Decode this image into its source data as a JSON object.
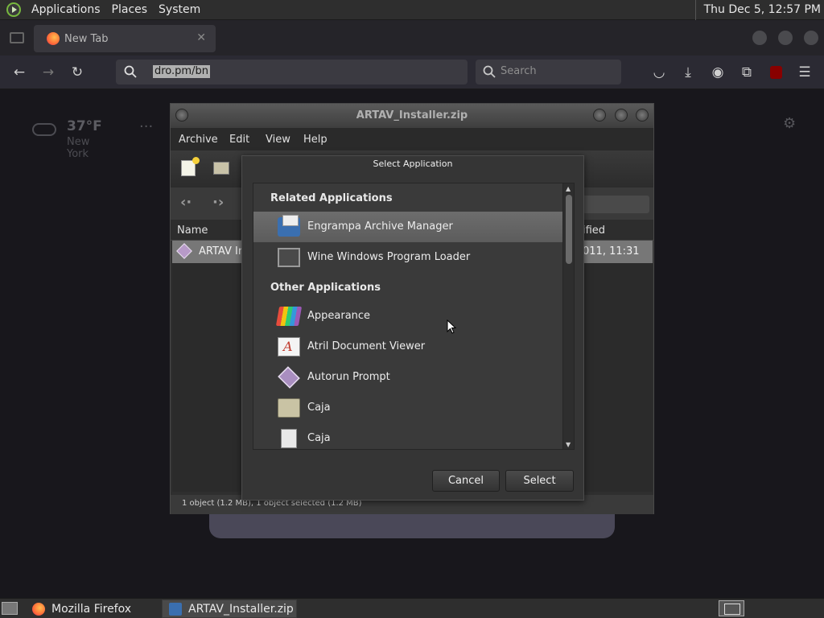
{
  "top_panel": {
    "menus": [
      "Applications",
      "Places",
      "System"
    ],
    "clock": "Thu Dec  5, 12:57 PM"
  },
  "firefox": {
    "tab_title": "New Tab",
    "url": "dro.pm/bn",
    "search_placeholder": "Search",
    "weather": {
      "temp": "37°F",
      "city": "New York"
    }
  },
  "engrampa": {
    "title": "ARTAV_Installer.zip",
    "menus": [
      "Archive",
      "Edit",
      "View",
      "Help"
    ],
    "columns": {
      "name": "Name",
      "modified": "ified"
    },
    "file": {
      "name": "ARTAV In",
      "modified": "011, 11:31"
    },
    "status": "1 object (1.2 MB), 1 object selected (1.2 MB)"
  },
  "dialog": {
    "title": "Select Application",
    "related_header": "Related Applications",
    "related": [
      {
        "label": "Engrampa Archive Manager",
        "icon": "engrampa-icon",
        "selected": true
      },
      {
        "label": "Wine Windows Program Loader",
        "icon": "wine-icon"
      }
    ],
    "other_header": "Other Applications",
    "other": [
      {
        "label": "Appearance",
        "icon": "appearance-icon"
      },
      {
        "label": "Atril Document Viewer",
        "icon": "atril-icon"
      },
      {
        "label": "Autorun Prompt",
        "icon": "autorun-icon"
      },
      {
        "label": "Caja",
        "icon": "folder-icon"
      },
      {
        "label": "Caja",
        "icon": "file-cabinet-icon"
      }
    ],
    "cancel_label": "Cancel",
    "select_label": "Select"
  },
  "taskbar": {
    "tasks": [
      {
        "label": "Mozilla Firefox",
        "icon": "firefox-icon"
      },
      {
        "label": "ARTAV_Installer.zip",
        "icon": "engrampa-icon",
        "active": true
      }
    ]
  }
}
